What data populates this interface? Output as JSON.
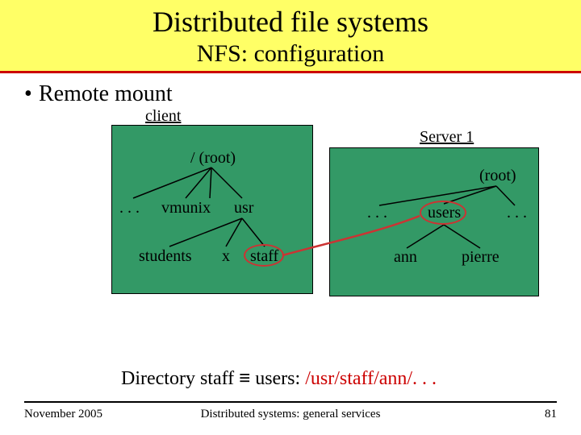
{
  "title": "Distributed file systems",
  "subtitle": "NFS: configuration",
  "bullet": "Remote mount",
  "diagram": {
    "client_label": "client",
    "server_label": "Server 1",
    "root_client": "/ (root)",
    "root_server": "(root)",
    "dots": ". . .",
    "vmunix": "vmunix",
    "usr": "usr",
    "users": "users",
    "students": "students",
    "x": "x",
    "staff": "staff",
    "ann": "ann",
    "pierre": "pierre"
  },
  "mapping": {
    "prefix": "Directory staff ",
    "equiv": "≡",
    "mid": " users:  ",
    "path": "/usr/staff/ann/. . ."
  },
  "footer": {
    "date": "November 2005",
    "course": "Distributed systems: general services",
    "page": "81"
  }
}
